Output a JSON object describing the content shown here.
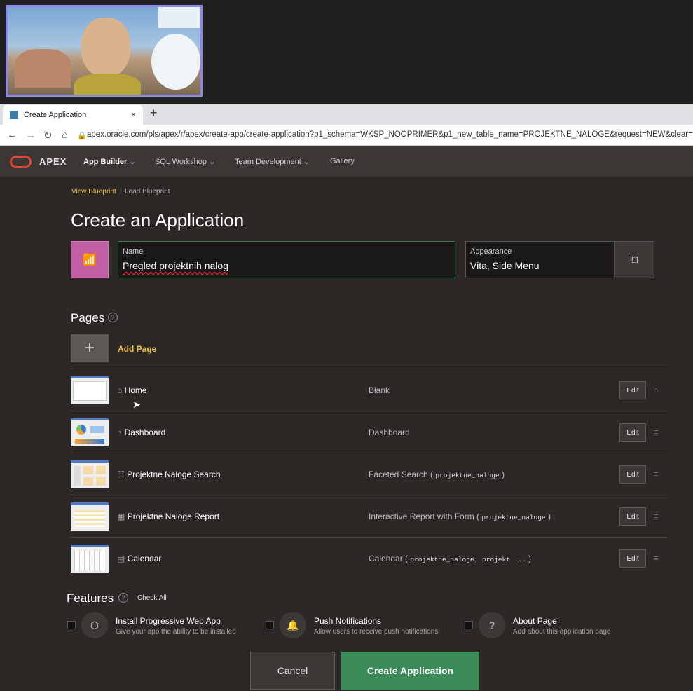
{
  "browser": {
    "tab_title": "Create Application",
    "tab_close": "×",
    "new_tab": "+",
    "url": "apex.oracle.com/pls/apex/r/apex/create-app/create-application?p1_schema=WKSP_NOOPRIMER&p1_new_table_name=PROJEKTNE_NALOGE&request=NEW&clear="
  },
  "apex": {
    "logo": "APEX",
    "menu": [
      {
        "label": "App Builder"
      },
      {
        "label": "SQL Workshop"
      },
      {
        "label": "Team Development"
      },
      {
        "label": "Gallery"
      }
    ]
  },
  "breadcrumb": {
    "view_blueprint": "View Blueprint",
    "load_blueprint": "Load Blueprint"
  },
  "page_title": "Create an Application",
  "form": {
    "name_label": "Name",
    "name_value": "Pregled projektnih nalog",
    "appearance_label": "Appearance",
    "appearance_value": "Vita, Side Menu"
  },
  "pages": {
    "heading": "Pages",
    "add_page": "Add Page",
    "edit_label": "Edit",
    "rows": [
      {
        "name": "Home",
        "type": "Blank",
        "table": ""
      },
      {
        "name": "Dashboard",
        "type": "Dashboard",
        "table": ""
      },
      {
        "name": "Projektne Naloge Search",
        "type": "Faceted Search (",
        "table": "projektne_naloge"
      },
      {
        "name": "Projektne Naloge Report",
        "type": "Interactive Report with Form (",
        "table": "projektne_naloge"
      },
      {
        "name": "Calendar",
        "type": "Calendar (",
        "table": "projektne_naloge; projekt ..."
      }
    ]
  },
  "features": {
    "heading": "Features",
    "check_all": "Check All",
    "items": [
      {
        "title": "Install Progressive Web App",
        "desc": "Give your app the ability to be installed"
      },
      {
        "title": "Push Notifications",
        "desc": "Allow users to receive push notifications"
      },
      {
        "title": "About Page",
        "desc": "Add about this application page"
      }
    ]
  },
  "buttons": {
    "cancel": "Cancel",
    "create": "Create Application"
  },
  "colors": {
    "accent": "#f0c14b",
    "create_button": "#3c8c5a",
    "app_icon": "#c25fa4"
  }
}
